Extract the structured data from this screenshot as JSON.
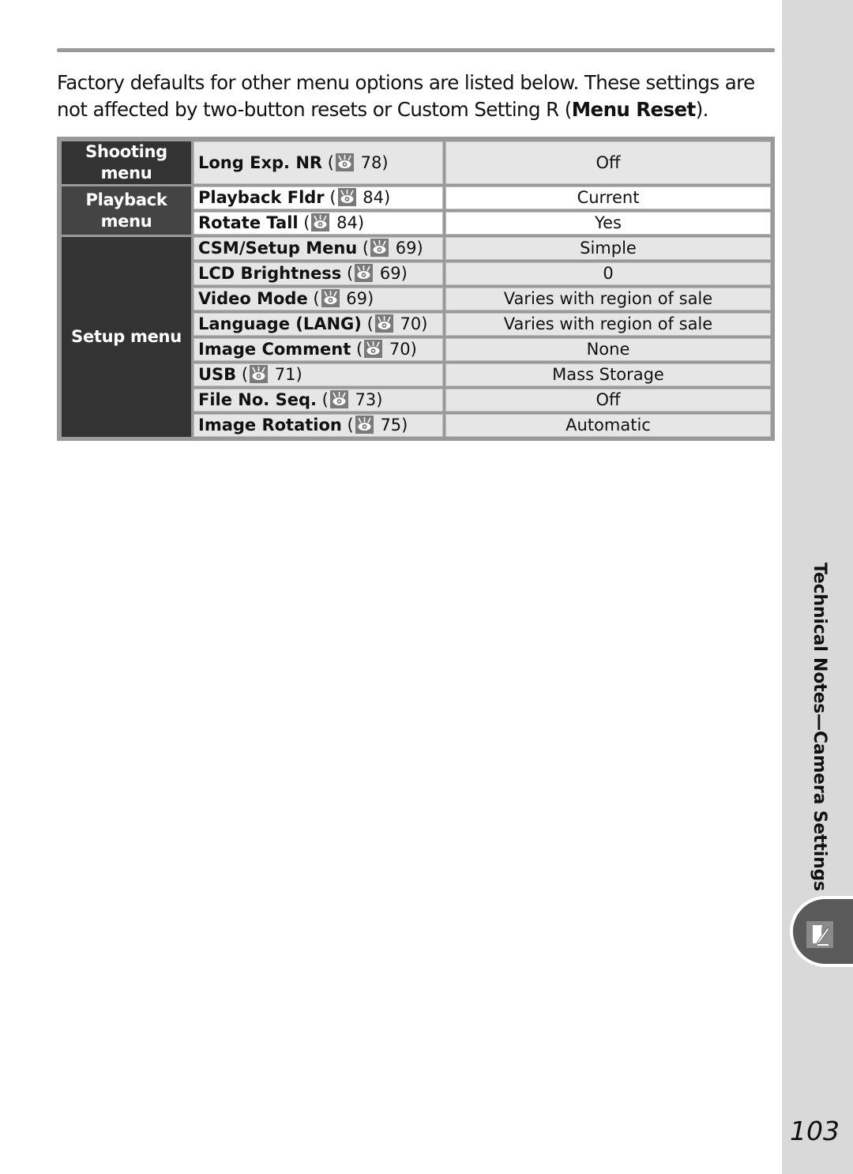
{
  "page": {
    "intro_text_1": "Factory defaults for other menu options are listed below.  These settings are not affected by two-button resets or Custom Setting R (",
    "intro_bold": "Menu Reset",
    "intro_text_2": ").",
    "page_number": "103",
    "section_title": "Technical Notes—Camera Settings"
  },
  "table": {
    "groups": [
      {
        "category": "Shooting menu",
        "rows": [
          {
            "option": "Long Exp. NR",
            "ref_page": "78",
            "default": "Off"
          }
        ]
      },
      {
        "category": "Playback menu",
        "rows": [
          {
            "option": "Playback Fldr",
            "ref_page": "84",
            "default": "Current"
          },
          {
            "option": "Rotate Tall",
            "ref_page": "84",
            "default": "Yes"
          }
        ]
      },
      {
        "category": "Setup menu",
        "rows": [
          {
            "option": "CSM/Setup Menu",
            "ref_page": "69",
            "default": "Simple"
          },
          {
            "option": "LCD Brightness",
            "ref_page": "69",
            "default": "0"
          },
          {
            "option": "Video Mode",
            "ref_page": "69",
            "default": "Varies with region of sale"
          },
          {
            "option": "Language (LANG)",
            "ref_page": "70",
            "default": "Varies with region of sale"
          },
          {
            "option": "Image Comment",
            "ref_page": "70",
            "default": "None"
          },
          {
            "option": "USB",
            "ref_page": "71",
            "default": "Mass Storage"
          },
          {
            "option": "File No. Seq.",
            "ref_page": "73",
            "default": "Off"
          },
          {
            "option": "Image Rotation",
            "ref_page": "75",
            "default": "Automatic"
          }
        ]
      }
    ]
  },
  "icons": {
    "reference": "eye-reference-icon",
    "section_tab": "pen-and-paper-icon"
  }
}
